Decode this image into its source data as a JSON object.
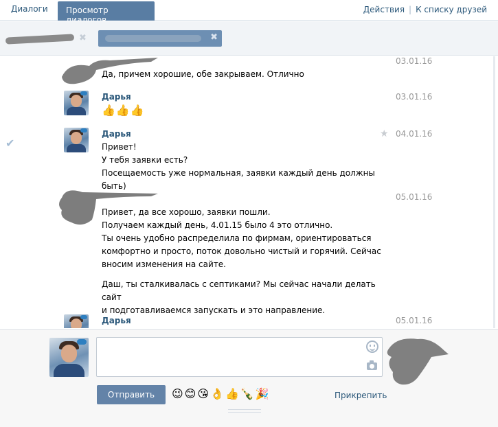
{
  "tabs": {
    "dialogs": "Диалоги",
    "view": "Просмотр диалогов"
  },
  "top_actions": {
    "actions": "Действия",
    "separator": "|",
    "friends": "К списку друзей"
  },
  "participants": {
    "close_glyph": "✖"
  },
  "messages": [
    {
      "author": "",
      "date": "03.01.16",
      "lines": [
        "Да, причем хорошие, обе закрываем. Отлично"
      ]
    },
    {
      "author": "Дарья",
      "date": "03.01.16",
      "thumbs": "👍👍👍"
    },
    {
      "author": "Дарья",
      "date": "04.01.16",
      "lines": [
        "Привет!",
        "У тебя заявки есть?",
        "Посещаемость уже нормальная, заявки каждый день должны быть)"
      ]
    },
    {
      "author": "",
      "date": "05.01.16",
      "paragraph1": [
        "Привет, да все хорошо, заявки пошли.",
        "Получаем каждый день, 4.01.15 было 4 это отлично.",
        "Ты очень удобно распределила по фирмам, ориентироваться",
        "комфортно и просто, поток довольно чистый и горячий. Сейчас",
        "вносим изменения на сайте."
      ],
      "paragraph2": [
        "Даш, ты сталкивалась с септиками? Мы сейчас начали делать сайт",
        "и подготавливаемся запускать и это направление."
      ]
    },
    {
      "author": "Дарья",
      "date": "05.01.16"
    }
  ],
  "icons": {
    "star": "★",
    "check": "✔"
  },
  "composer": {
    "send_label": "Отправить",
    "emojis": "😉😊😘👌👍🍾🎉",
    "attach_label": "Прикрепить"
  },
  "colors": {
    "accent": "#597da3",
    "link": "#2b587a",
    "button": "#6383a8"
  }
}
